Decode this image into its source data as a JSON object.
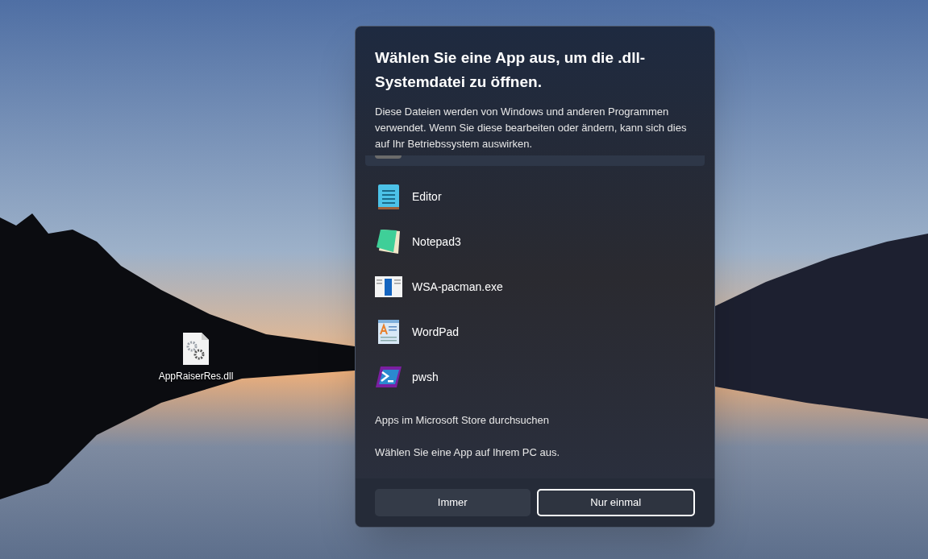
{
  "desktop": {
    "icons": [
      {
        "label": "AppRaiserRes.dll"
      }
    ]
  },
  "dialog": {
    "title": "Wählen Sie eine App aus, um die .dll-Systemdatei zu öffnen.",
    "description": "Diese Dateien werden von Windows und anderen Programmen verwendet. Wenn Sie diese bearbeiten oder ändern, kann sich dies auf Ihr Betriebssystem auswirken.",
    "apps": [
      {
        "name": "Editor",
        "kind": "notepad",
        "selected": false
      },
      {
        "name": "Notepad3",
        "kind": "notepad3",
        "selected": false
      },
      {
        "name": "WSA-pacman.exe",
        "kind": "window",
        "selected": false
      },
      {
        "name": "WordPad",
        "kind": "wordpad",
        "selected": false
      },
      {
        "name": "pwsh",
        "kind": "terminal",
        "selected": false
      }
    ],
    "links": [
      "Apps im Microsoft Store durchsuchen",
      "Wählen Sie eine App auf Ihrem PC aus."
    ],
    "buttons": [
      {
        "label": "Immer",
        "focused": false
      },
      {
        "label": "Nur einmal",
        "focused": true
      }
    ]
  }
}
